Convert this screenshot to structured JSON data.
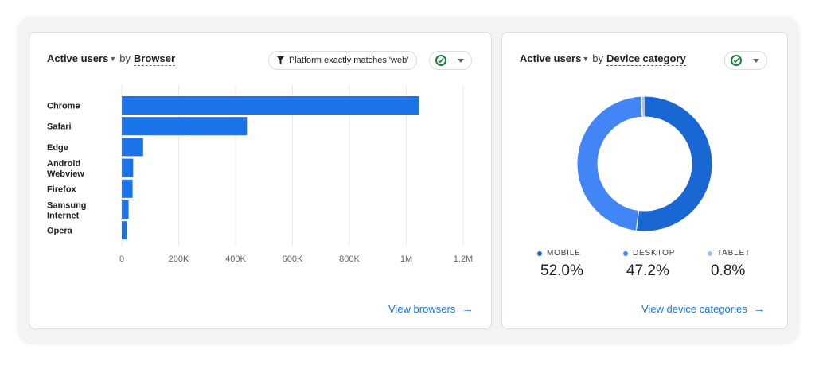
{
  "browser_card": {
    "metric": "Active users",
    "by": "by",
    "dimension": "Browser",
    "filter_label": "Platform exactly matches 'web'",
    "view_link": "View browsers"
  },
  "device_card": {
    "metric": "Active users",
    "by": "by",
    "dimension": "Device category",
    "view_link": "View device categories"
  },
  "colors": {
    "bar": "#1a73e8",
    "mobile": "#1967d2",
    "desktop": "#4285f4",
    "tablet": "#a1c2fa",
    "link": "#1a73e8",
    "check": "#188038"
  },
  "icons": {
    "filter": "filter-icon",
    "check": "check-circle-icon",
    "dropdown": "chevron-down-icon",
    "arrow": "arrow-right-icon"
  },
  "chart_data": [
    {
      "type": "bar",
      "orientation": "horizontal",
      "categories": [
        [
          "Chrome"
        ],
        [
          "Safari"
        ],
        [
          "Edge"
        ],
        [
          "Android",
          "Webview"
        ],
        [
          "Firefox"
        ],
        [
          "Samsung",
          "Internet"
        ],
        [
          "Opera"
        ]
      ],
      "values": [
        1045000,
        440000,
        75000,
        40000,
        38000,
        24000,
        18000
      ],
      "xlim": [
        0,
        1200000
      ],
      "x_ticks": [
        0,
        200000,
        400000,
        600000,
        800000,
        1000000,
        1200000
      ],
      "x_tick_labels": [
        "0",
        "200K",
        "400K",
        "600K",
        "800K",
        "1M",
        "1.2M"
      ],
      "grid": true
    },
    {
      "type": "pie",
      "donut": true,
      "slices": [
        {
          "label": "MOBILE",
          "value": 52.0,
          "display": "52.0%"
        },
        {
          "label": "DESKTOP",
          "value": 47.2,
          "display": "47.2%"
        },
        {
          "label": "TABLET",
          "value": 0.8,
          "display": "0.8%"
        }
      ]
    }
  ]
}
